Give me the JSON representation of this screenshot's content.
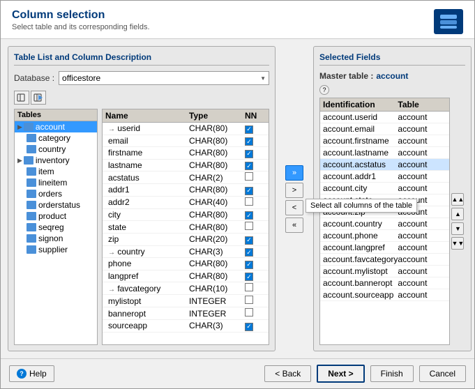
{
  "window": {
    "title": "Column selection",
    "subtitle": "Select table and its corresponding fields."
  },
  "left_panel": {
    "header": "Table List and Column Description",
    "database_label": "Database :",
    "database_value": "officestore",
    "tables_header": "Tables",
    "tables": [
      {
        "name": "account",
        "has_expand": true,
        "selected": true
      },
      {
        "name": "category",
        "has_expand": false,
        "selected": false
      },
      {
        "name": "country",
        "has_expand": false,
        "selected": false
      },
      {
        "name": "inventory",
        "has_expand": true,
        "selected": false
      },
      {
        "name": "item",
        "has_expand": false,
        "selected": false
      },
      {
        "name": "lineitem",
        "has_expand": false,
        "selected": false
      },
      {
        "name": "orders",
        "has_expand": false,
        "selected": false
      },
      {
        "name": "orderstatus",
        "has_expand": false,
        "selected": false
      },
      {
        "name": "product",
        "has_expand": false,
        "selected": false
      },
      {
        "name": "seqreg",
        "has_expand": false,
        "selected": false
      },
      {
        "name": "signon",
        "has_expand": false,
        "selected": false
      },
      {
        "name": "supplier",
        "has_expand": false,
        "selected": false
      }
    ],
    "columns_header": [
      "Name",
      "Type",
      "NN"
    ],
    "columns": [
      {
        "name": "userid",
        "type": "CHAR(80)",
        "nn": true,
        "arrow": "→"
      },
      {
        "name": "email",
        "type": "CHAR(80)",
        "nn": true,
        "arrow": ""
      },
      {
        "name": "firstname",
        "type": "CHAR(80)",
        "nn": true,
        "arrow": ""
      },
      {
        "name": "lastname",
        "type": "CHAR(80)",
        "nn": true,
        "arrow": ""
      },
      {
        "name": "acstatus",
        "type": "CHAR(2)",
        "nn": false,
        "arrow": ""
      },
      {
        "name": "addr1",
        "type": "CHAR(80)",
        "nn": true,
        "arrow": ""
      },
      {
        "name": "addr2",
        "type": "CHAR(40)",
        "nn": false,
        "arrow": ""
      },
      {
        "name": "city",
        "type": "CHAR(80)",
        "nn": true,
        "arrow": ""
      },
      {
        "name": "state",
        "type": "CHAR(80)",
        "nn": false,
        "arrow": ""
      },
      {
        "name": "zip",
        "type": "CHAR(20)",
        "nn": true,
        "arrow": ""
      },
      {
        "name": "country",
        "type": "CHAR(3)",
        "nn": true,
        "arrow": "→"
      },
      {
        "name": "phone",
        "type": "CHAR(80)",
        "nn": true,
        "arrow": ""
      },
      {
        "name": "langpref",
        "type": "CHAR(80)",
        "nn": true,
        "arrow": ""
      },
      {
        "name": "favcategory",
        "type": "CHAR(10)",
        "nn": false,
        "arrow": "→"
      },
      {
        "name": "mylistopt",
        "type": "INTEGER",
        "nn": false,
        "arrow": ""
      },
      {
        "name": "banneropt",
        "type": "INTEGER",
        "nn": false,
        "arrow": ""
      },
      {
        "name": "sourceapp",
        "type": "CHAR(3)",
        "nn": true,
        "arrow": ""
      }
    ]
  },
  "middle_buttons": {
    "add_all": "»",
    "add_one": ">",
    "remove_one": "<",
    "remove_all": "«",
    "tooltip": "Select all columns of the table"
  },
  "right_panel": {
    "header": "Selected Fields",
    "master_label": "Master table :",
    "master_value": "account",
    "help_symbol": "?",
    "columns_header": [
      "Identification",
      "Table"
    ],
    "selected_fields": [
      {
        "id": "account.userid",
        "table": "account"
      },
      {
        "id": "account.email",
        "table": "account"
      },
      {
        "id": "account.firstname",
        "table": "account"
      },
      {
        "id": "account.lastname",
        "table": "account"
      },
      {
        "id": "account.acstatus",
        "table": "account",
        "highlighted": true
      },
      {
        "id": "account.addr1",
        "table": "account"
      },
      {
        "id": "account.city",
        "table": "account"
      },
      {
        "id": "account.state",
        "table": "account"
      },
      {
        "id": "account.zip",
        "table": "account"
      },
      {
        "id": "account.country",
        "table": "account"
      },
      {
        "id": "account.phone",
        "table": "account"
      },
      {
        "id": "account.langpref",
        "table": "account"
      },
      {
        "id": "account.favcategory",
        "table": "account"
      },
      {
        "id": "account.mylistopt",
        "table": "account"
      },
      {
        "id": "account.banneropt",
        "table": "account"
      },
      {
        "id": "account.sourceapp",
        "table": "account"
      }
    ],
    "move_buttons": [
      "▲▲",
      "▲",
      "▼",
      "▼▼"
    ]
  },
  "footer": {
    "help_label": "Help",
    "back_label": "< Back",
    "next_label": "Next >",
    "finish_label": "Finish",
    "cancel_label": "Cancel"
  }
}
